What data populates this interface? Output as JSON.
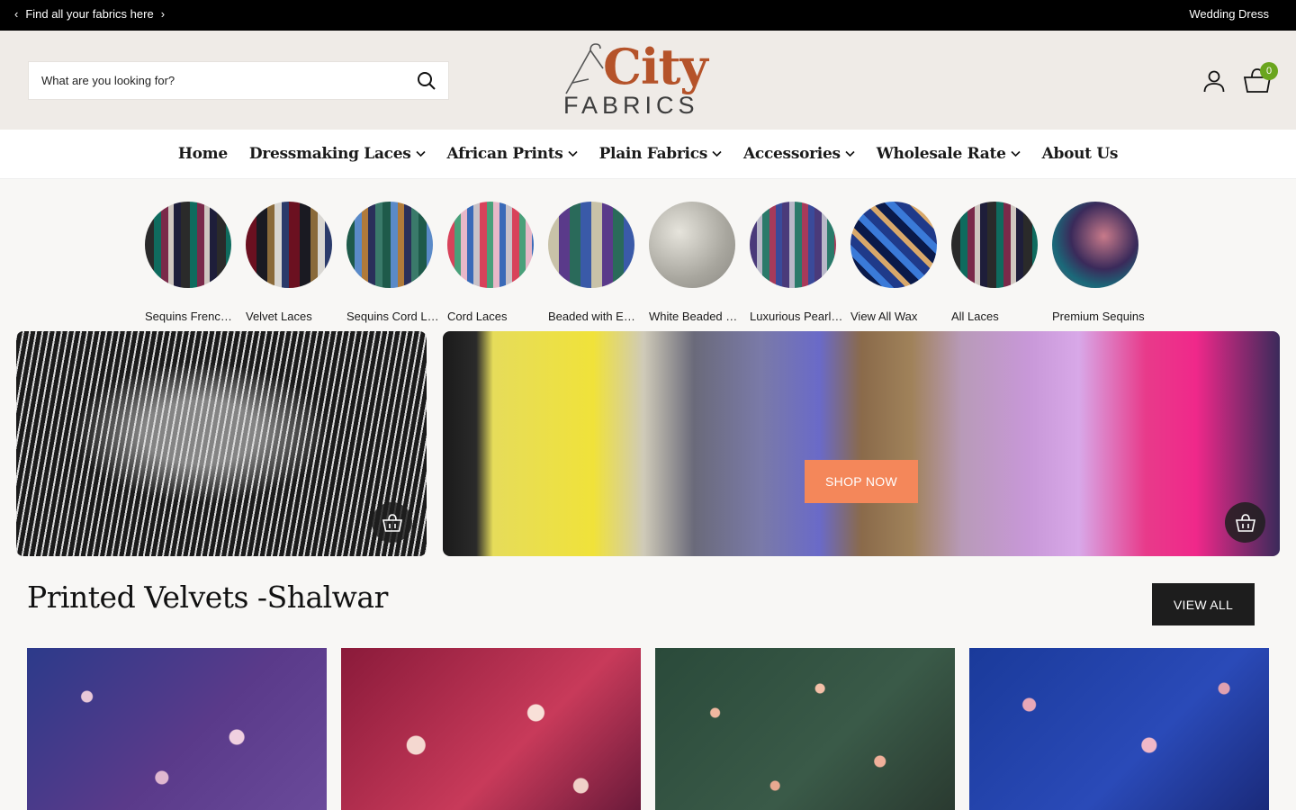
{
  "announcement": {
    "left_text": "Find all your fabrics here",
    "prev_arrow": "‹",
    "next_arrow": "›",
    "right_text": "Wedding Dress"
  },
  "header": {
    "search_placeholder": "What are you looking for?",
    "logo_word_1": "City",
    "logo_word_2": "FABRICS",
    "cart_count": "0",
    "icons": [
      "search-icon",
      "account-icon",
      "cart-icon"
    ]
  },
  "nav": {
    "items": [
      {
        "label": "Home",
        "dropdown": false
      },
      {
        "label": "Dressmaking Laces",
        "dropdown": true
      },
      {
        "label": "African Prints",
        "dropdown": true
      },
      {
        "label": "Plain Fabrics",
        "dropdown": true
      },
      {
        "label": "Accessories",
        "dropdown": true
      },
      {
        "label": "Wholesale Rate",
        "dropdown": true
      },
      {
        "label": "About Us",
        "dropdown": false
      }
    ]
  },
  "categories": [
    {
      "label": "Sequins French Laces"
    },
    {
      "label": "Velvet Laces"
    },
    {
      "label": "Sequins Cord Laces"
    },
    {
      "label": "Cord Laces"
    },
    {
      "label": "Beaded with Embroidery"
    },
    {
      "label": "White Beaded Laces"
    },
    {
      "label": "Luxurious Pearl Laces"
    },
    {
      "label": "View All Wax"
    },
    {
      "label": "All Laces"
    },
    {
      "label": "Premium Sequins"
    }
  ],
  "banners": {
    "shop_now_label": "SHOP NOW"
  },
  "section": {
    "title": "Printed Velvets -Shalwar",
    "view_all_label": "VIEW ALL"
  },
  "colors": {
    "accent": "#f4875a",
    "logo_brown": "#b5532a",
    "cart_badge": "#6aa51e",
    "header_bg": "#efebe7"
  }
}
